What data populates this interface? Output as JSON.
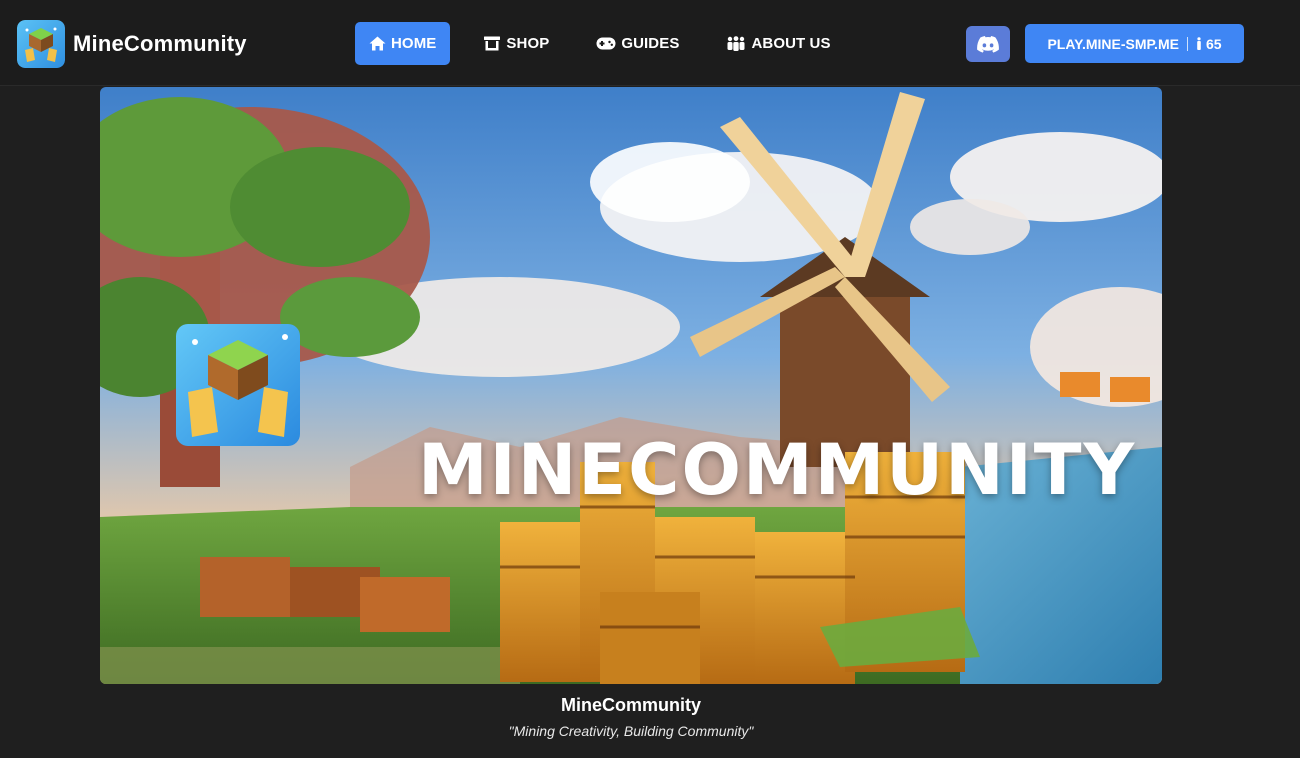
{
  "navbar": {
    "brand_name": "MineCommunity",
    "links": [
      {
        "label": "HOME",
        "icon": "home-icon",
        "active": true
      },
      {
        "label": "SHOP",
        "icon": "store-icon",
        "active": false
      },
      {
        "label": "GUIDES",
        "icon": "gamepad-icon",
        "active": false
      },
      {
        "label": "ABOUT US",
        "icon": "people-icon",
        "active": false
      }
    ],
    "discord_icon": "discord-icon",
    "server_ip": "PLAY.MINE-SMP.ME",
    "player_count": "65"
  },
  "hero": {
    "banner_text": "MINECOMMUNITY"
  },
  "caption": {
    "title": "MineCommunity",
    "tagline": "\"Mining Creativity, Building Community\""
  },
  "colors": {
    "page_bg": "#1f1f1f",
    "accent_blue": "#3f86f4",
    "discord_blue": "#5b7cd8"
  }
}
